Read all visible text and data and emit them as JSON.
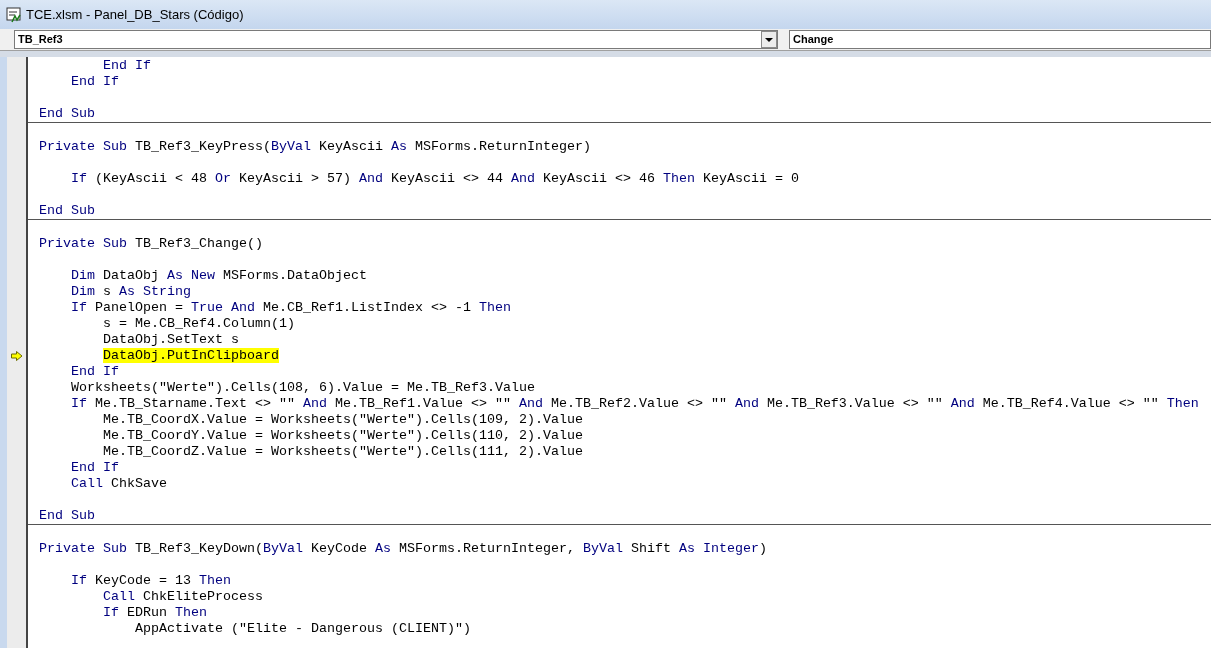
{
  "window": {
    "title": "TCE.xlsm - Panel_DB_Stars (Código)"
  },
  "object_dropdown": {
    "value": "TB_Ref3"
  },
  "procedure_dropdown": {
    "value": "Change"
  },
  "procedures": [
    {
      "lines": [
        {
          "execution_point": false,
          "segments": [
            {
              "kind": "keyword",
              "text": "        End If"
            }
          ]
        },
        {
          "execution_point": false,
          "segments": [
            {
              "kind": "keyword",
              "text": "    End If"
            }
          ]
        },
        {
          "execution_point": false
        },
        {
          "execution_point": false,
          "segments": [
            {
              "kind": "keyword",
              "text": "End Sub"
            }
          ]
        }
      ]
    },
    {
      "lines": [
        {
          "execution_point": false
        },
        {
          "execution_point": false,
          "segments": [
            {
              "kind": "keyword",
              "text": "Private Sub"
            },
            {
              "kind": "plain",
              "text": " TB_Ref3_KeyPress("
            },
            {
              "kind": "keyword",
              "text": "ByVal"
            },
            {
              "kind": "plain",
              "text": " KeyAscii "
            },
            {
              "kind": "keyword",
              "text": "As"
            },
            {
              "kind": "plain",
              "text": " MSForms.ReturnInteger)"
            }
          ]
        },
        {
          "execution_point": false
        },
        {
          "execution_point": false,
          "segments": [
            {
              "kind": "keyword",
              "text": "    If"
            },
            {
              "kind": "plain",
              "text": " (KeyAscii < 48 "
            },
            {
              "kind": "keyword",
              "text": "Or"
            },
            {
              "kind": "plain",
              "text": " KeyAscii > 57) "
            },
            {
              "kind": "keyword",
              "text": "And"
            },
            {
              "kind": "plain",
              "text": " KeyAscii <> 44 "
            },
            {
              "kind": "keyword",
              "text": "And"
            },
            {
              "kind": "plain",
              "text": " KeyAscii <> 46 "
            },
            {
              "kind": "keyword",
              "text": "Then"
            },
            {
              "kind": "plain",
              "text": " KeyAscii = 0"
            }
          ]
        },
        {
          "execution_point": false
        },
        {
          "execution_point": false,
          "segments": [
            {
              "kind": "keyword",
              "text": "End Sub"
            }
          ]
        }
      ]
    },
    {
      "lines": [
        {
          "execution_point": false
        },
        {
          "execution_point": false,
          "segments": [
            {
              "kind": "keyword",
              "text": "Private Sub"
            },
            {
              "kind": "plain",
              "text": " TB_Ref3_Change()"
            }
          ]
        },
        {
          "execution_point": false
        },
        {
          "execution_point": false,
          "segments": [
            {
              "kind": "keyword",
              "text": "    Dim"
            },
            {
              "kind": "plain",
              "text": " DataObj "
            },
            {
              "kind": "keyword",
              "text": "As New"
            },
            {
              "kind": "plain",
              "text": " MSForms.DataObject"
            }
          ]
        },
        {
          "execution_point": false,
          "segments": [
            {
              "kind": "keyword",
              "text": "    Dim"
            },
            {
              "kind": "plain",
              "text": " s "
            },
            {
              "kind": "keyword",
              "text": "As String"
            }
          ]
        },
        {
          "execution_point": false,
          "segments": [
            {
              "kind": "keyword",
              "text": "    If"
            },
            {
              "kind": "plain",
              "text": " PanelOpen = "
            },
            {
              "kind": "keyword",
              "text": "True And"
            },
            {
              "kind": "plain",
              "text": " Me.CB_Ref1.ListIndex <> -1 "
            },
            {
              "kind": "keyword",
              "text": "Then"
            }
          ]
        },
        {
          "execution_point": false,
          "segments": [
            {
              "kind": "plain",
              "text": "        s = Me.CB_Ref4.Column(1)"
            }
          ]
        },
        {
          "execution_point": false,
          "segments": [
            {
              "kind": "plain",
              "text": "        DataObj.SetText s"
            }
          ]
        },
        {
          "execution_point": true,
          "segments": [
            {
              "kind": "plain",
              "text": "        DataObj.PutInClipboard"
            }
          ]
        },
        {
          "execution_point": false,
          "segments": [
            {
              "kind": "keyword",
              "text": "    End If"
            }
          ]
        },
        {
          "execution_point": false,
          "segments": [
            {
              "kind": "plain",
              "text": "    Worksheets(\"Werte\").Cells(108, 6).Value = Me.TB_Ref3.Value"
            }
          ]
        },
        {
          "execution_point": false,
          "segments": [
            {
              "kind": "keyword",
              "text": "    If"
            },
            {
              "kind": "plain",
              "text": " Me.TB_Starname.Text <> \"\" "
            },
            {
              "kind": "keyword",
              "text": "And"
            },
            {
              "kind": "plain",
              "text": " Me.TB_Ref1.Value <> \"\" "
            },
            {
              "kind": "keyword",
              "text": "And"
            },
            {
              "kind": "plain",
              "text": " Me.TB_Ref2.Value <> \"\" "
            },
            {
              "kind": "keyword",
              "text": "And"
            },
            {
              "kind": "plain",
              "text": " Me.TB_Ref3.Value <> \"\" "
            },
            {
              "kind": "keyword",
              "text": "And"
            },
            {
              "kind": "plain",
              "text": " Me.TB_Ref4.Value <> \"\" "
            },
            {
              "kind": "keyword",
              "text": "Then"
            }
          ]
        },
        {
          "execution_point": false,
          "segments": [
            {
              "kind": "plain",
              "text": "        Me.TB_CoordX.Value = Worksheets(\"Werte\").Cells(109, 2).Value"
            }
          ]
        },
        {
          "execution_point": false,
          "segments": [
            {
              "kind": "plain",
              "text": "        Me.TB_CoordY.Value = Worksheets(\"Werte\").Cells(110, 2).Value"
            }
          ]
        },
        {
          "execution_point": false,
          "segments": [
            {
              "kind": "plain",
              "text": "        Me.TB_CoordZ.Value = Worksheets(\"Werte\").Cells(111, 2).Value"
            }
          ]
        },
        {
          "execution_point": false,
          "segments": [
            {
              "kind": "keyword",
              "text": "    End If"
            }
          ]
        },
        {
          "execution_point": false,
          "segments": [
            {
              "kind": "keyword",
              "text": "    Call"
            },
            {
              "kind": "plain",
              "text": " ChkSave"
            }
          ]
        },
        {
          "execution_point": false
        },
        {
          "execution_point": false,
          "segments": [
            {
              "kind": "keyword",
              "text": "End Sub"
            }
          ]
        }
      ]
    },
    {
      "lines": [
        {
          "execution_point": false
        },
        {
          "execution_point": false,
          "segments": [
            {
              "kind": "keyword",
              "text": "Private Sub"
            },
            {
              "kind": "plain",
              "text": " TB_Ref3_KeyDown("
            },
            {
              "kind": "keyword",
              "text": "ByVal"
            },
            {
              "kind": "plain",
              "text": " KeyCode "
            },
            {
              "kind": "keyword",
              "text": "As"
            },
            {
              "kind": "plain",
              "text": " MSForms.ReturnInteger, "
            },
            {
              "kind": "keyword",
              "text": "ByVal"
            },
            {
              "kind": "plain",
              "text": " Shift "
            },
            {
              "kind": "keyword",
              "text": "As Integer"
            },
            {
              "kind": "plain",
              "text": ")"
            }
          ]
        },
        {
          "execution_point": false
        },
        {
          "execution_point": false,
          "segments": [
            {
              "kind": "keyword",
              "text": "    If"
            },
            {
              "kind": "plain",
              "text": " KeyCode = 13 "
            },
            {
              "kind": "keyword",
              "text": "Then"
            }
          ]
        },
        {
          "execution_point": false,
          "segments": [
            {
              "kind": "keyword",
              "text": "        Call"
            },
            {
              "kind": "plain",
              "text": " ChkEliteProcess"
            }
          ]
        },
        {
          "execution_point": false,
          "segments": [
            {
              "kind": "keyword",
              "text": "        If"
            },
            {
              "kind": "plain",
              "text": " EDRun "
            },
            {
              "kind": "keyword",
              "text": "Then"
            }
          ]
        },
        {
          "execution_point": false,
          "segments": [
            {
              "kind": "plain",
              "text": "            AppActivate (\"Elite - Dangerous (CLIENT)\")"
            }
          ]
        }
      ]
    }
  ]
}
